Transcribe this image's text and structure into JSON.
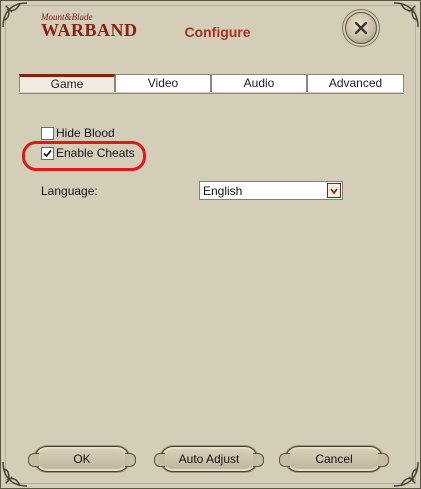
{
  "logo": {
    "small": "Mount&Blade",
    "big": "WARBAND"
  },
  "window": {
    "title": "Configure"
  },
  "tabs": [
    {
      "label": "Game",
      "active": true
    },
    {
      "label": "Video",
      "active": false
    },
    {
      "label": "Audio",
      "active": false
    },
    {
      "label": "Advanced",
      "active": false
    }
  ],
  "options": {
    "hide_blood": {
      "label": "Hide Blood",
      "checked": false
    },
    "enable_cheats": {
      "label": "Enable Cheats",
      "checked": true
    }
  },
  "language": {
    "label": "Language:",
    "value": "English"
  },
  "buttons": {
    "ok": "OK",
    "auto_adjust": "Auto Adjust",
    "cancel": "Cancel"
  },
  "colors": {
    "accent": "#8a1f14",
    "title": "#a8321c",
    "background": "#d4cdb8",
    "highlight": "#e01818"
  },
  "icons": {
    "close": "close-x-icon",
    "check": "check-icon",
    "dropdown": "chevron-down-icon"
  }
}
